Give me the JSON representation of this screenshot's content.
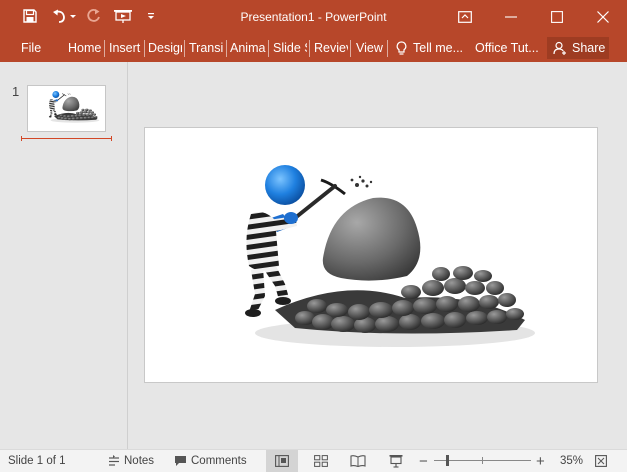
{
  "app": {
    "title": "Presentation1 - PowerPoint",
    "accent_color": "#b7472a"
  },
  "qat": [
    {
      "name": "save-icon"
    },
    {
      "name": "undo-icon"
    },
    {
      "name": "undo-dropdown-icon"
    },
    {
      "name": "redo-icon"
    },
    {
      "name": "start-from-beginning-icon"
    },
    {
      "name": "customize-qat-icon"
    }
  ],
  "window_controls": [
    {
      "name": "ribbon-display-options-icon"
    },
    {
      "name": "minimize-icon"
    },
    {
      "name": "maximize-icon"
    },
    {
      "name": "close-icon"
    }
  ],
  "ribbon": {
    "tabs": [
      "File",
      "Home",
      "Insert",
      "Design",
      "Transitions",
      "Animations",
      "Slide Show",
      "Review",
      "View"
    ],
    "tabs_visible": [
      "File",
      "Home",
      "Insert",
      "Desigr",
      "Transi",
      "Anima",
      "Slide S",
      "Reviev",
      "View"
    ],
    "tell_me": "Tell me...",
    "office_tut": "Office Tut...",
    "share": "Share"
  },
  "thumbnails": [
    {
      "number": "1",
      "selected": true
    }
  ],
  "status": {
    "slide_info": "Slide 1 of 1",
    "notes": "Notes",
    "comments": "Comments",
    "zoom": "35%",
    "zoom_value": 35,
    "views": [
      {
        "name": "normal-view-icon",
        "active": true
      },
      {
        "name": "slide-sorter-view-icon",
        "active": false
      },
      {
        "name": "reading-view-icon",
        "active": false
      },
      {
        "name": "slide-show-view-icon",
        "active": false
      }
    ]
  }
}
